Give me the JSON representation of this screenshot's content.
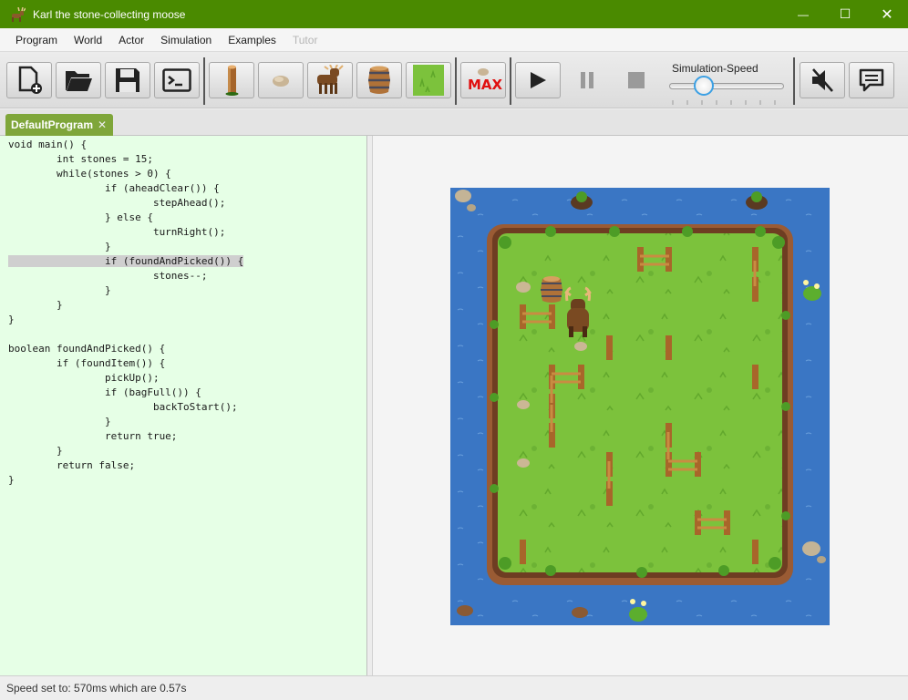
{
  "window": {
    "title": "Karl the stone-collecting moose",
    "minimize": "—",
    "maximize": "☐",
    "close": "✕"
  },
  "menu": [
    "Program",
    "World",
    "Actor",
    "Simulation",
    "Examples",
    "Tutor"
  ],
  "toolbar": {
    "buttons": [
      "new-file",
      "open-folder",
      "save",
      "terminal",
      "tree-stump",
      "stone",
      "moose",
      "barrel",
      "grass",
      "max",
      "play",
      "pause",
      "stop",
      "mute",
      "chat"
    ],
    "max_label": "MAX",
    "speed_label": "Simulation-Speed",
    "speed_fraction": 0.22
  },
  "tab": {
    "label": "DefaultProgram",
    "close": "✕"
  },
  "editor": {
    "lines": [
      "void main() {",
      "        int stones = 15;",
      "        while(stones > 0) {",
      "                if (aheadClear()) {",
      "                        stepAhead();",
      "                } else {",
      "                        turnRight();",
      "                }",
      "                if (foundAndPicked()) {",
      "                        stones--;",
      "                }",
      "        }",
      "}",
      "",
      "boolean foundAndPicked() {",
      "        if (foundItem()) {",
      "                pickUp();",
      "                if (bagFull()) {",
      "                        backToStart();",
      "                }",
      "                return true;",
      "        }",
      "        return false;",
      "}"
    ],
    "highlight_line": 8
  },
  "status": {
    "text": "Speed set to: 570ms which are 0.57s"
  },
  "colors": {
    "title_bg": "#4a8a00",
    "editor_bg": "#e6ffe6",
    "water": "#3a76c4",
    "grass": "#7cc23c",
    "max_red": "#e01010"
  }
}
